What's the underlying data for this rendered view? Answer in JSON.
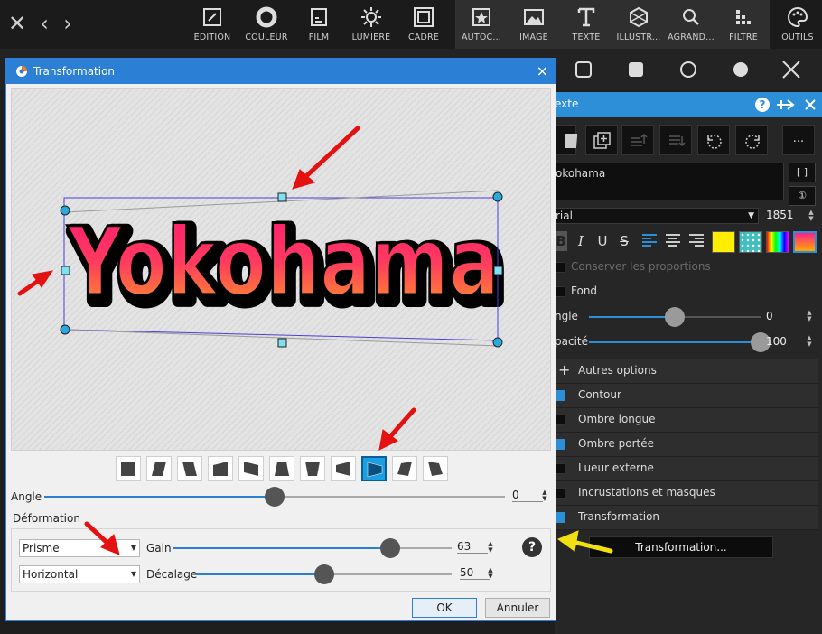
{
  "topbar": {
    "tools": [
      {
        "label": "EDITION",
        "icon": "edit-icon"
      },
      {
        "label": "COULEUR",
        "icon": "color-ring-icon"
      },
      {
        "label": "FILM",
        "icon": "film-icon"
      },
      {
        "label": "LUMIÈRE",
        "icon": "sun-icon"
      },
      {
        "label": "CADRE",
        "icon": "frame-icon"
      },
      {
        "label": "AUTOC...",
        "icon": "sticker-icon"
      },
      {
        "label": "IMAGE",
        "icon": "image-icon"
      },
      {
        "label": "TEXTE",
        "icon": "text-icon"
      },
      {
        "label": "ILLUSTR...",
        "icon": "illustration-icon"
      },
      {
        "label": "AGRAND...",
        "icon": "magnify-icon"
      },
      {
        "label": "FILTRE",
        "icon": "filter-icon"
      },
      {
        "label": "OUTILS",
        "icon": "palette-icon"
      }
    ]
  },
  "panel": {
    "title": "exte",
    "text_value": "okohama",
    "font_name": "rial",
    "font_size": "1851",
    "keep_proportions": "Conserver les proportions",
    "fond_label": "Fond",
    "angle_label": "ngle",
    "angle_value": "0",
    "angle_fraction": 0.5,
    "opacity_label": "pacité",
    "opacity_value": "100",
    "opacity_fraction": 1.0,
    "autres_options": "Autres options",
    "options": [
      {
        "label": "Contour",
        "checked": true
      },
      {
        "label": "Ombre longue",
        "checked": false
      },
      {
        "label": "Ombre portée",
        "checked": true
      },
      {
        "label": "Lueur externe",
        "checked": false
      },
      {
        "label": "Incrustations et masques",
        "checked": false
      },
      {
        "label": "Transformation",
        "checked": true
      }
    ],
    "transform_button": "Transformation...",
    "more_button": "...",
    "bracket_button": "[ ]",
    "info_button": "①",
    "swatch_colors": [
      "#ffee00",
      "#3fbfbf",
      "#ff00aa",
      "#ff4488"
    ]
  },
  "dialog": {
    "title": "Transformation",
    "preview_text": "Yokohama",
    "angle_label": "Angle",
    "angle_value": "0",
    "angle_fraction": 0.5,
    "deformation_label": "Déformation",
    "type_value": "Prisme",
    "orientation_value": "Horizontal",
    "gain_label": "Gain",
    "gain_value": "63",
    "gain_fraction": 0.78,
    "offset_label": "Décalage",
    "offset_value": "50",
    "offset_fraction": 0.5,
    "selected_shape_index": 8,
    "ok_label": "OK",
    "cancel_label": "Annuler",
    "help_label": "?",
    "close_label": "×"
  }
}
